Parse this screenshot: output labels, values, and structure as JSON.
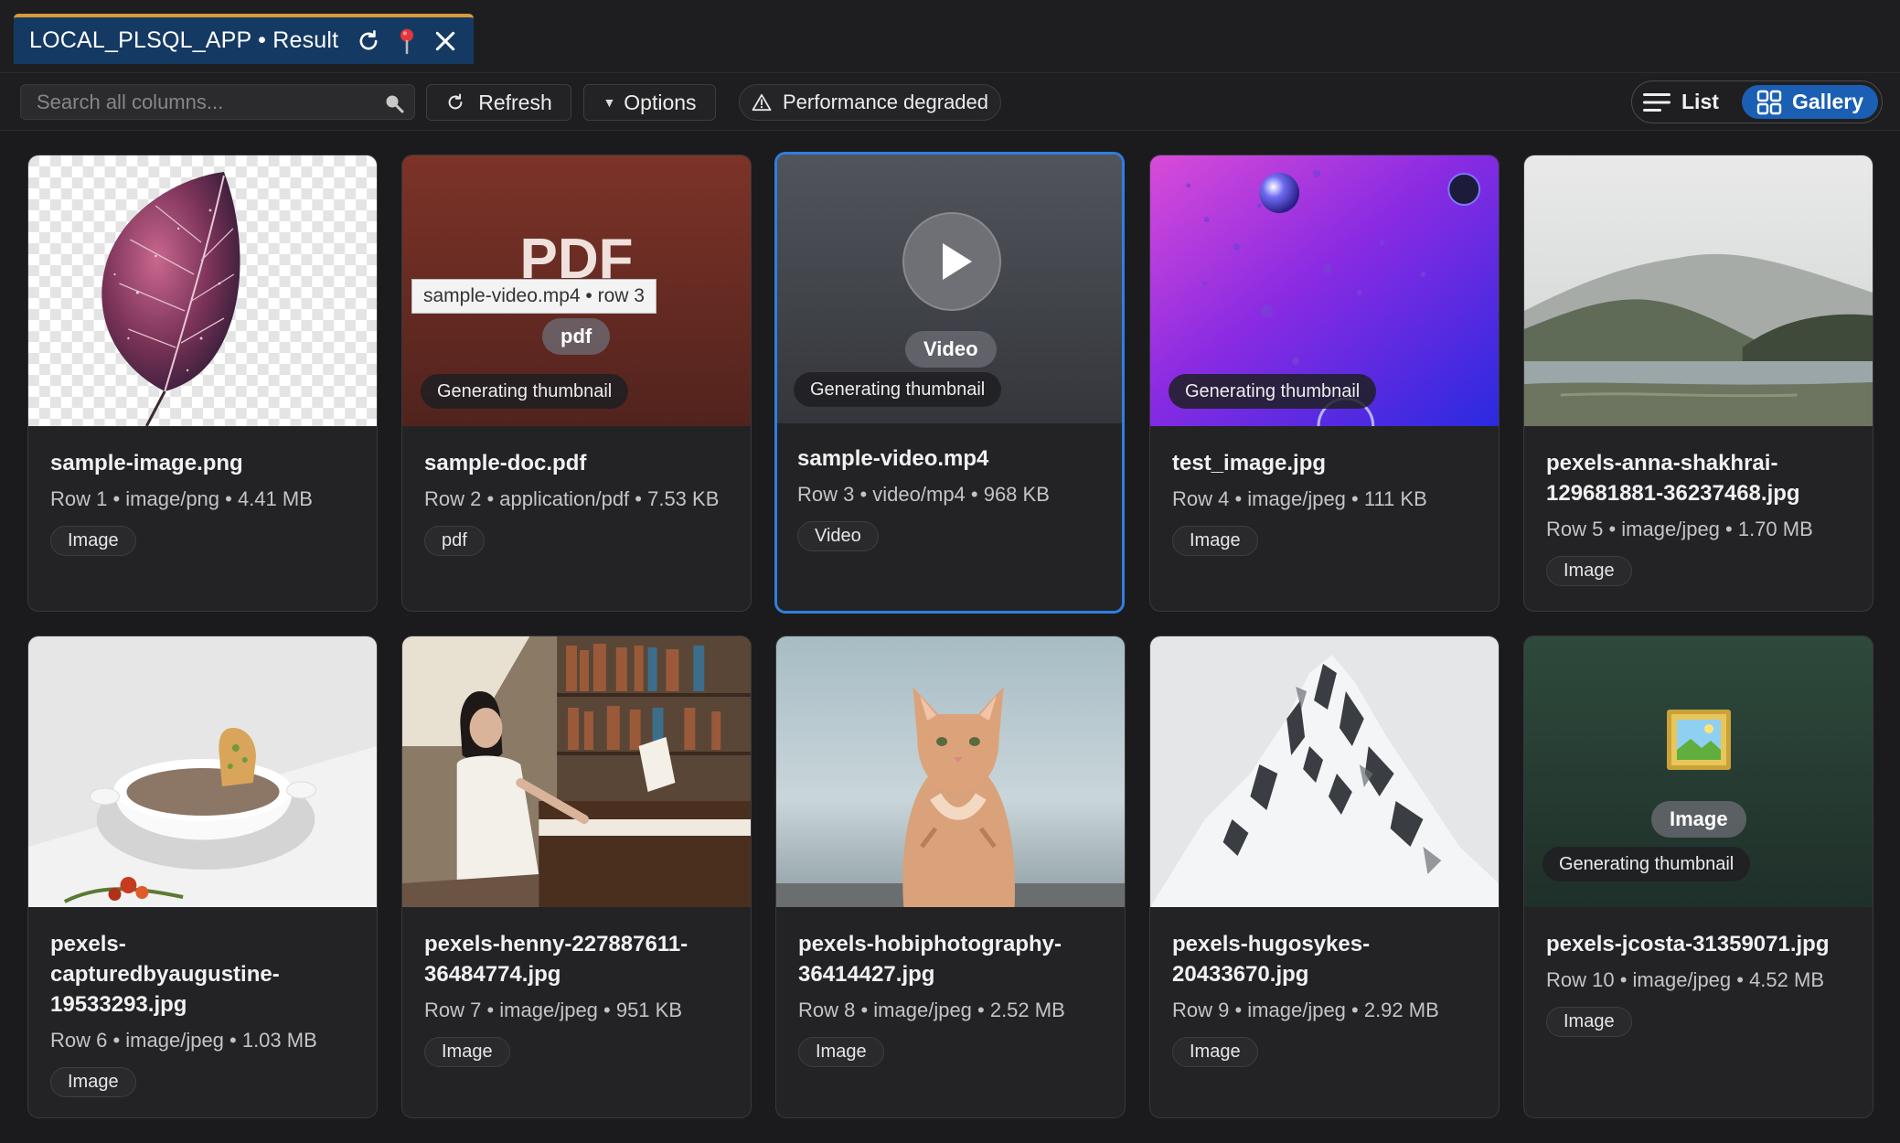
{
  "tab": {
    "title": "LOCAL_PLSQL_APP • Result",
    "icons": [
      "refresh-icon",
      "pin-icon",
      "close-icon"
    ]
  },
  "toolbar": {
    "search_placeholder": "Search all columns...",
    "refresh_label": "Refresh",
    "options_label": "Options",
    "performance_label": "Performance degraded",
    "view_list_label": "List",
    "view_gallery_label": "Gallery",
    "active_view": "Gallery"
  },
  "tooltip": "sample-video.mp4 • row 3",
  "cards": [
    {
      "title": "sample-image.png",
      "meta": "Row 1 • image/png • 4.41 MB",
      "tag": "Image"
    },
    {
      "title": "sample-doc.pdf",
      "meta": "Row 2 • application/pdf • 7.53 KB",
      "tag": "pdf",
      "thumb_text": "PDF",
      "type_pill": "pdf",
      "badge": "Generating thumbnail"
    },
    {
      "title": "sample-video.mp4",
      "meta": "Row 3 • video/mp4 • 968 KB",
      "tag": "Video",
      "type_pill": "Video",
      "badge": "Generating thumbnail",
      "selected": true
    },
    {
      "title": "test_image.jpg",
      "meta": "Row 4 • image/jpeg • 111 KB",
      "tag": "Image",
      "badge": "Generating thumbnail"
    },
    {
      "title": "pexels-anna-shakhrai-129681881-36237468.jpg",
      "meta": "Row 5 • image/jpeg • 1.70 MB",
      "tag": "Image"
    },
    {
      "title": "pexels-capturedbyaugustine-19533293.jpg",
      "meta": "Row 6 • image/jpeg • 1.03 MB",
      "tag": "Image"
    },
    {
      "title": "pexels-henny-227887611-36484774.jpg",
      "meta": "Row 7 • image/jpeg • 951 KB",
      "tag": "Image"
    },
    {
      "title": "pexels-hobiphotography-36414427.jpg",
      "meta": "Row 8 • image/jpeg • 2.52 MB",
      "tag": "Image"
    },
    {
      "title": "pexels-hugosykes-20433670.jpg",
      "meta": "Row 9 • image/jpeg • 2.92 MB",
      "tag": "Image"
    },
    {
      "title": "pexels-jcosta-31359071.jpg",
      "meta": "Row 10 • image/jpeg • 4.52 MB",
      "tag": "Image",
      "type_pill": "Image",
      "badge": "Generating thumbnail"
    }
  ],
  "colors": {
    "accent": "#1a5fb4",
    "tab_bg": "#143a63",
    "tab_top": "#d89b3a",
    "selected_border": "#2f7fe0"
  }
}
